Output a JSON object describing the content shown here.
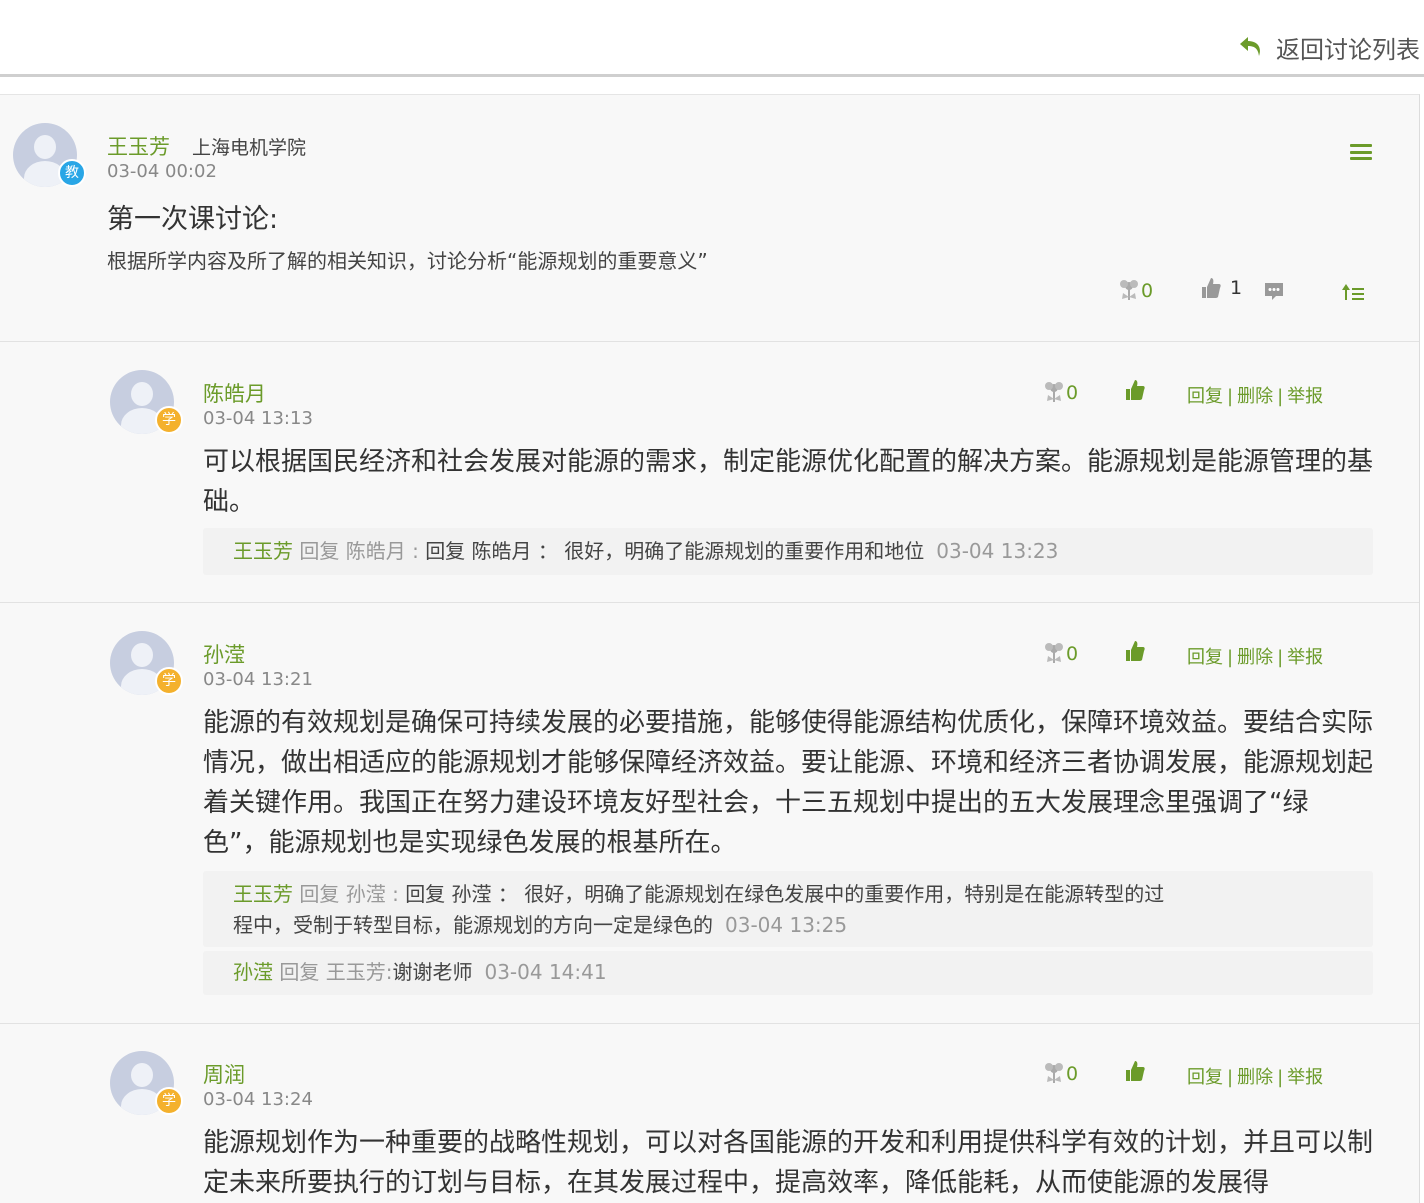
{
  "header": {
    "back_label": "返回讨论列表"
  },
  "topic": {
    "author": "王玉芳",
    "school": "上海电机学院",
    "role_badge": "教",
    "time": "03-04 00:02",
    "title": "第一次课讨论:",
    "description": "根据所学内容及所了解的相关知识，讨论分析“能源规划的重要意义”",
    "flower_count": "0",
    "like_count": "1"
  },
  "comment_actions": {
    "reply": "回复",
    "separator": "|",
    "delete": "删除",
    "report": "举报"
  },
  "comments": [
    {
      "author": "陈皓月",
      "role_badge": "学",
      "time": "03-04 13:13",
      "flower_count": "0",
      "content": "可以根据国民经济和社会发展对能源的需求，制定能源优化配置的解决方案。能源规划是能源管理的基础。",
      "replies": [
        {
          "author": "王玉芳",
          "word": "回复",
          "target": "陈皓月 :",
          "text": "回复 陈皓月 ： 很好，明确了能源规划的重要作用和地位",
          "time": "03-04 13:23"
        }
      ]
    },
    {
      "author": "孙滢",
      "role_badge": "学",
      "time": "03-04 13:21",
      "flower_count": "0",
      "content": "能源的有效规划是确保可持续发展的必要措施，能够使得能源结构优质化，保障环境效益。要结合实际情况，做出相适应的能源规划才能够保障经济效益。要让能源、环境和经济三者协调发展，能源规划起着关键作用。我国正在努力建设环境友好型社会，十三五规划中提出的五大发展理念里强调了“绿色”，能源规划也是实现绿色发展的根基所在。",
      "replies": [
        {
          "author": "王玉芳",
          "word": "回复",
          "target": "孙滢 :",
          "text": "回复 孙滢 ： 很好，明确了能源规划在绿色发展中的重要作用，特别是在能源转型的过程中，受制于转型目标，能源规划的方向一定是绿色的",
          "time": "03-04 13:25"
        },
        {
          "author": "孙滢",
          "word": "回复",
          "target": "王玉芳:",
          "text": "谢谢老师",
          "time": "03-04 14:41"
        }
      ]
    },
    {
      "author": "周润",
      "role_badge": "学",
      "time": "03-04 13:24",
      "flower_count": "0",
      "content": "能源规划作为一种重要的战略性规划，可以对各国能源的开发和利用提供科学有效的计划，并且可以制定未来所要执行的订划与目标，在其发展过程中，提高效率，降低能耗，从而使能源的发展得",
      "replies": []
    }
  ],
  "colors": {
    "accent": "#6b9b2a",
    "teacher_badge": "#29a6e6",
    "student_badge": "#f4b12d"
  },
  "icons": [
    "return-arrow-icon",
    "menu-icon",
    "flower-icon",
    "thumbs-up-icon",
    "comment-icon",
    "sort-icon"
  ]
}
